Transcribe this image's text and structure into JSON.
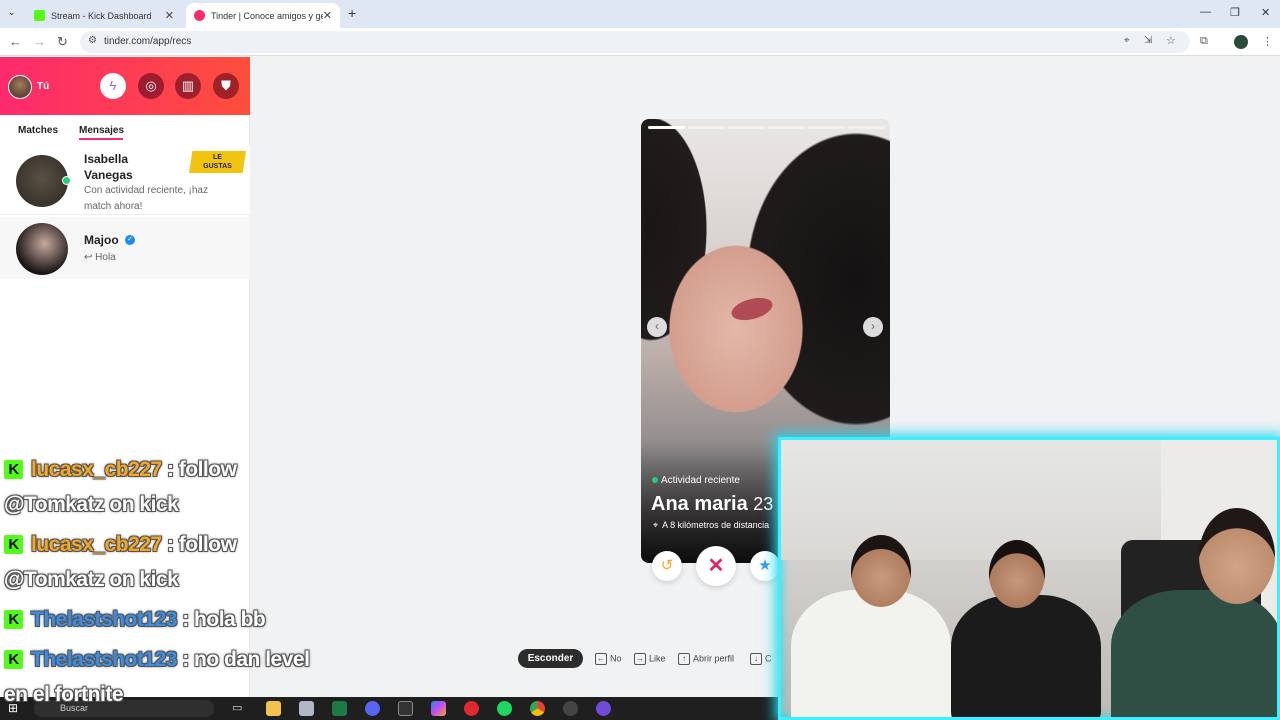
{
  "browser": {
    "tabs": [
      {
        "title": "Stream - Kick Dashboard",
        "favicon": "kick-icon",
        "color": "#53fc18"
      },
      {
        "title": "Tinder | Conoce amigos y gente",
        "favicon": "tinder-icon",
        "color": "#fd2a6e"
      }
    ],
    "url": "tinder.com/app/recs"
  },
  "sidebar": {
    "me_label": "Tú",
    "header_buttons": [
      "boost-icon",
      "explore-icon",
      "gift-icon",
      "safety-icon"
    ],
    "tabs": [
      "Matches",
      "Mensajes"
    ],
    "active_tab": "Mensajes",
    "conversations": [
      {
        "name": "Isabella Vanegas",
        "message": "Con actividad reciente, ¡haz match ahora!",
        "badge": "LE GUSTAS",
        "online": true
      },
      {
        "name": "Majoo",
        "message": "↩ Hola",
        "verified": true
      }
    ]
  },
  "card": {
    "photo_count": 6,
    "active_photo": 1,
    "activity": "Actividad reciente",
    "name": "Ana maria",
    "age": "23",
    "distance": "A 8 kilómetros de distancia"
  },
  "hints": {
    "hide_label": "Esconder",
    "no": "No",
    "like": "Like",
    "open_profile": "Abrir perfil",
    "more": "C"
  },
  "taskbar": {
    "search_placeholder": "Buscar"
  },
  "chat": [
    {
      "user": "lucasx_cb227",
      "text": ": follow",
      "color": "#f5a623"
    },
    {
      "user": "",
      "text": "@Tomkatz on kick"
    },
    {
      "user": "lucasx_cb227",
      "text": ": follow",
      "color": "#f5a623"
    },
    {
      "user": "",
      "text": "@Tomkatz on kick"
    },
    {
      "user": "Thelastshot123",
      "text": ": hola bb",
      "color": "#3a8ee6"
    },
    {
      "user": "Thelastshot123",
      "text": ": no dan level",
      "color": "#3a8ee6"
    },
    {
      "user": "",
      "text": "en el fortnite"
    }
  ],
  "colors": {
    "tinder_gradient_start": "#fd2a6e",
    "tinder_gradient_end": "#fe4e3c",
    "kick_green": "#53fc18",
    "webcam_border": "#3ef0ff"
  }
}
